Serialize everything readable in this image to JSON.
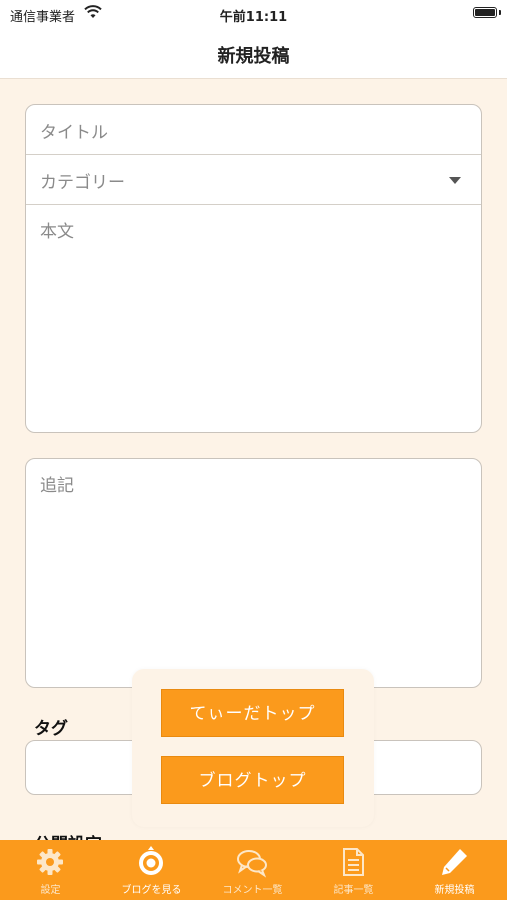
{
  "status": {
    "carrier": "通信事業者",
    "time": "午前11:11"
  },
  "nav": {
    "title": "新規投稿"
  },
  "form": {
    "title_placeholder": "タイトル",
    "category_placeholder": "カテゴリー",
    "body_placeholder": "本文",
    "addendum_placeholder": "追記",
    "tag_label": "タグ",
    "publish_label": "公開設定"
  },
  "popup": {
    "buttons": [
      "てぃーだトップ",
      "ブログトップ"
    ]
  },
  "tabbar": {
    "items": [
      {
        "label": "設定",
        "icon": "gear-icon"
      },
      {
        "label": "ブログを見る",
        "icon": "target-icon"
      },
      {
        "label": "コメント一覧",
        "icon": "chat-bubbles-icon"
      },
      {
        "label": "記事一覧",
        "icon": "document-icon"
      },
      {
        "label": "新規投稿",
        "icon": "pen-icon"
      }
    ],
    "active_index": 4
  },
  "colors": {
    "accent": "#fb9a1c",
    "background": "#fdf3e7"
  }
}
